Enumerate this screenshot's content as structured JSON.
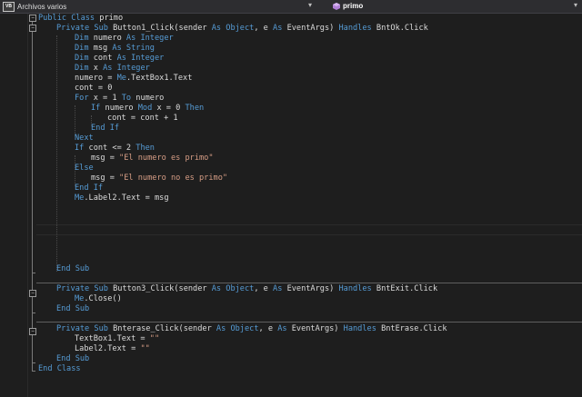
{
  "toolbar": {
    "class_dropdown": "Archivos varios",
    "member_dropdown": "primo",
    "class_icon": "vb-project-icon",
    "member_icon": "method-icon"
  },
  "colors": {
    "background": "#1e1e1e",
    "keyword": "#569cd6",
    "string": "#d69d85",
    "text": "#dcdcdc"
  },
  "code": {
    "lines": [
      [
        {
          "t": "Public Class ",
          "c": "kw"
        },
        {
          "t": "primo",
          "c": "id"
        }
      ],
      [
        {
          "t": "Private Sub ",
          "c": "kw"
        },
        {
          "t": "Button1_Click(sender ",
          "c": "id"
        },
        {
          "t": "As Object",
          "c": "kw"
        },
        {
          "t": ", e ",
          "c": "id"
        },
        {
          "t": "As ",
          "c": "kw"
        },
        {
          "t": "EventArgs) ",
          "c": "id"
        },
        {
          "t": "Handles ",
          "c": "kw"
        },
        {
          "t": "BntOk.Click",
          "c": "id"
        }
      ],
      [
        {
          "t": "Dim ",
          "c": "kw"
        },
        {
          "t": "numero ",
          "c": "id"
        },
        {
          "t": "As Integer",
          "c": "kw"
        }
      ],
      [
        {
          "t": "Dim ",
          "c": "kw"
        },
        {
          "t": "msg ",
          "c": "id"
        },
        {
          "t": "As String",
          "c": "kw"
        }
      ],
      [
        {
          "t": "Dim ",
          "c": "kw"
        },
        {
          "t": "cont ",
          "c": "id"
        },
        {
          "t": "As Integer",
          "c": "kw"
        }
      ],
      [
        {
          "t": "Dim ",
          "c": "kw"
        },
        {
          "t": "x ",
          "c": "id"
        },
        {
          "t": "As Integer",
          "c": "kw"
        }
      ],
      [
        {
          "t": "numero = ",
          "c": "id"
        },
        {
          "t": "Me",
          "c": "kw"
        },
        {
          "t": ".TextBox1.Text",
          "c": "id"
        }
      ],
      [
        {
          "t": "cont = 0",
          "c": "id"
        }
      ],
      [
        {
          "t": "For ",
          "c": "kw"
        },
        {
          "t": "x = 1 ",
          "c": "id"
        },
        {
          "t": "To ",
          "c": "kw"
        },
        {
          "t": "numero",
          "c": "id"
        }
      ],
      [
        {
          "t": "If ",
          "c": "kw"
        },
        {
          "t": "numero ",
          "c": "id"
        },
        {
          "t": "Mod ",
          "c": "kw"
        },
        {
          "t": "x = 0 ",
          "c": "id"
        },
        {
          "t": "Then",
          "c": "kw"
        }
      ],
      [
        {
          "t": "cont = cont + 1",
          "c": "id"
        }
      ],
      [
        {
          "t": "End If",
          "c": "kw"
        }
      ],
      [
        {
          "t": "Next",
          "c": "kw"
        }
      ],
      [
        {
          "t": "If ",
          "c": "kw"
        },
        {
          "t": "cont <= 2 ",
          "c": "id"
        },
        {
          "t": "Then",
          "c": "kw"
        }
      ],
      [
        {
          "t": "msg = ",
          "c": "id"
        },
        {
          "t": "\"El numero es primo\"",
          "c": "str"
        }
      ],
      [
        {
          "t": "Else",
          "c": "kw"
        }
      ],
      [
        {
          "t": "msg = ",
          "c": "id"
        },
        {
          "t": "\"El numero no es primo\"",
          "c": "str"
        }
      ],
      [
        {
          "t": "End If",
          "c": "kw"
        }
      ],
      [
        {
          "t": "Me",
          "c": "kw"
        },
        {
          "t": ".Label2.Text = msg",
          "c": "id"
        }
      ],
      [
        {
          "t": "End Sub",
          "c": "kw"
        }
      ],
      [
        {
          "t": "Private Sub ",
          "c": "kw"
        },
        {
          "t": "Button3_Click(sender ",
          "c": "id"
        },
        {
          "t": "As Object",
          "c": "kw"
        },
        {
          "t": ", e ",
          "c": "id"
        },
        {
          "t": "As ",
          "c": "kw"
        },
        {
          "t": "EventArgs) ",
          "c": "id"
        },
        {
          "t": "Handles ",
          "c": "kw"
        },
        {
          "t": "BntExit.Click",
          "c": "id"
        }
      ],
      [
        {
          "t": "Me",
          "c": "kw"
        },
        {
          "t": ".Close()",
          "c": "id"
        }
      ],
      [
        {
          "t": "End Sub",
          "c": "kw"
        }
      ],
      [
        {
          "t": "Private Sub ",
          "c": "kw"
        },
        {
          "t": "Bnterase_Click(sender ",
          "c": "id"
        },
        {
          "t": "As Object",
          "c": "kw"
        },
        {
          "t": ", e ",
          "c": "id"
        },
        {
          "t": "As ",
          "c": "kw"
        },
        {
          "t": "EventArgs) ",
          "c": "id"
        },
        {
          "t": "Handles ",
          "c": "kw"
        },
        {
          "t": "BntErase.Click",
          "c": "id"
        }
      ],
      [
        {
          "t": "TextBox1.Text = ",
          "c": "id"
        },
        {
          "t": "\"\"",
          "c": "str"
        }
      ],
      [
        {
          "t": "Label2.Text = ",
          "c": "id"
        },
        {
          "t": "\"\"",
          "c": "str"
        }
      ],
      [
        {
          "t": "End Sub",
          "c": "kw"
        }
      ],
      [
        {
          "t": "End Class",
          "c": "kw"
        }
      ]
    ]
  }
}
